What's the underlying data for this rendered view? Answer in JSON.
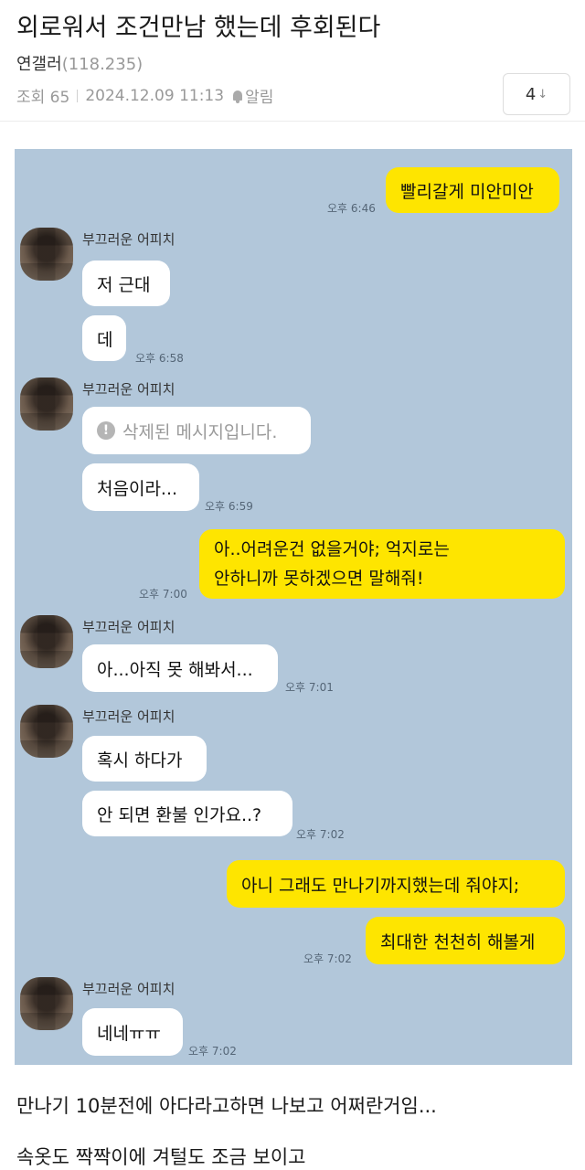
{
  "post": {
    "title": "외로워서 조건만남 했는데 후회된다",
    "author": "연갤러",
    "author_score": "(118.235)",
    "views": "조회 65",
    "date": "2024.12.09 11:13",
    "alert_label": "알림",
    "comment_count": "4",
    "comment_arrow": "↓"
  },
  "chat": {
    "sender_name": "부끄러운 어피치",
    "deleted_icon": "!",
    "messages": [
      {
        "text": "빨리갈게 미안미안",
        "time": "오후 6:46"
      },
      {
        "text": "저 근대"
      },
      {
        "text": "데",
        "time": "오후 6:58"
      },
      {
        "text": "삭제된 메시지입니다."
      },
      {
        "text": "처음이라...",
        "time": "오후 6:59"
      },
      {
        "line1": "아..어려운건 없을거야; 억지로는",
        "line2": "안하니까 못하겠으면 말해줘!",
        "time": "오후 7:00"
      },
      {
        "text": "아...아직 못 해봐서...",
        "time": "오후 7:01"
      },
      {
        "text": "혹시 하다가"
      },
      {
        "text": "안 되면 환불 인가요..?",
        "time": "오후 7:02"
      },
      {
        "text": "아니 그래도 만나기까지했는데 줘야지;"
      },
      {
        "text": "최대한 천천히 해볼게",
        "time": "오후 7:02"
      },
      {
        "text": "네네ㅠㅠ",
        "time": "오후 7:02"
      }
    ]
  },
  "body": {
    "line1": "만나기 10분전에 아다라고하면 나보고 어쩌란거임...",
    "line2": "속옷도 짝짝이에 겨털도 조금 보이고"
  },
  "colors": {
    "chat_background": "#b2c7da",
    "outgoing_bubble": "#fee500",
    "incoming_bubble": "#ffffff"
  },
  "icons": {
    "alert": "bell-icon",
    "deleted": "warning-icon",
    "comment_arrow": "arrow-down-icon"
  }
}
